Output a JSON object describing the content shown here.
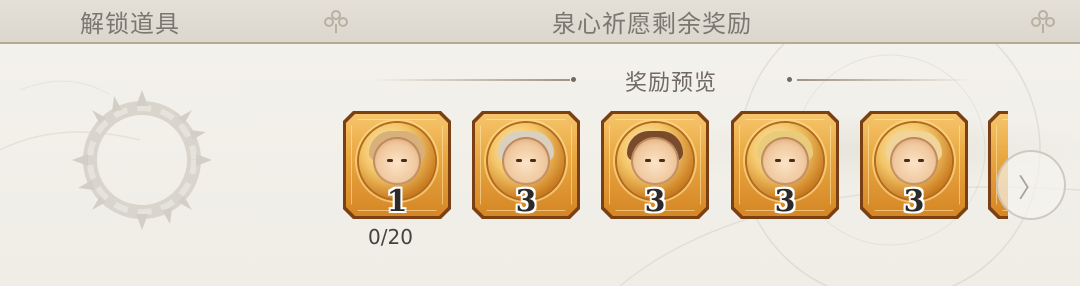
{
  "header": {
    "left_tab": "解锁道具",
    "title": "泉心祈愿剩余奖励"
  },
  "preview": {
    "title": "奖励预览"
  },
  "progress": "0/20",
  "rewards": [
    {
      "count": "1",
      "hair_color": "#d8b07a",
      "icon": "character-portrait-icon"
    },
    {
      "count": "3",
      "hair_color": "#d9d0c0",
      "icon": "character-portrait-icon"
    },
    {
      "count": "3",
      "hair_color": "#7a4a2c",
      "icon": "character-portrait-icon"
    },
    {
      "count": "3",
      "hair_color": "#e9cc7a",
      "icon": "character-portrait-icon"
    },
    {
      "count": "3",
      "hair_color": "#f0d49a",
      "icon": "character-portrait-icon"
    }
  ],
  "colors": {
    "frame_gold": "#e8a53f",
    "frame_dark": "#7a3f12",
    "text": "#7b7670"
  }
}
